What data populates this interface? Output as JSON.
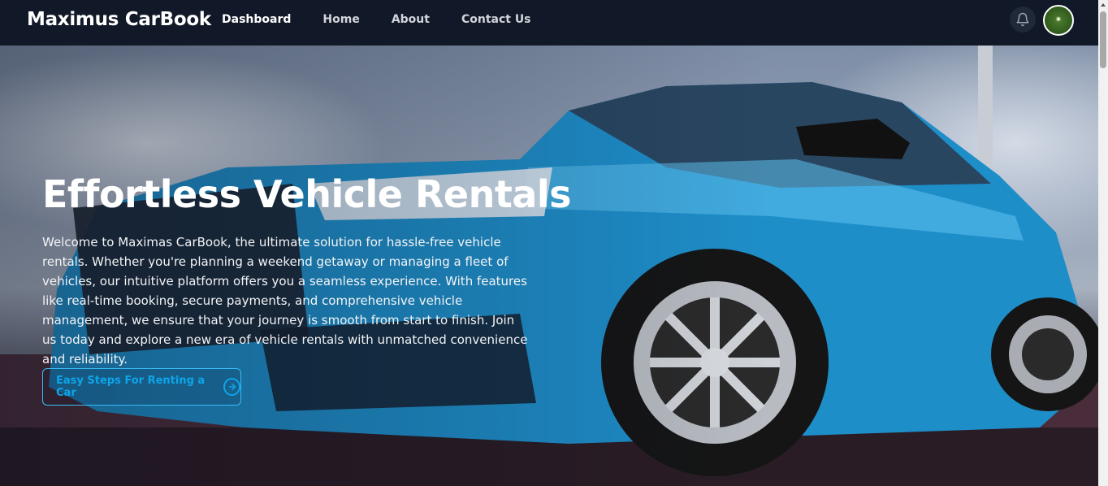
{
  "navbar": {
    "brand": "Maximus CarBook",
    "links": [
      {
        "label": "Dashboard",
        "active": true
      },
      {
        "label": "Home",
        "active": false
      },
      {
        "label": "About",
        "active": false
      },
      {
        "label": "Contact Us",
        "active": false
      }
    ],
    "icons": {
      "notifications": "bell-icon",
      "avatar": "user-avatar"
    }
  },
  "hero": {
    "title": "Effortless Vehicle Rentals",
    "description": "Welcome to Maximas CarBook, the ultimate solution for hassle-free vehicle rentals. Whether you're planning a weekend getaway or managing a fleet of vehicles, our intuitive platform offers you a seamless experience. With features like real-time booking, secure payments, and comprehensive vehicle management, we ensure that your journey is smooth from start to finish. Join us today and explore a new era of vehicle rentals with unmatched convenience and reliability.",
    "cta_label": "Easy Steps For Renting a Car",
    "cta_icon": "arrow-right-circle-icon"
  },
  "colors": {
    "nav_bg": "#111827",
    "accent": "#0ea5e9",
    "car_blue": "#1e8ec9"
  }
}
